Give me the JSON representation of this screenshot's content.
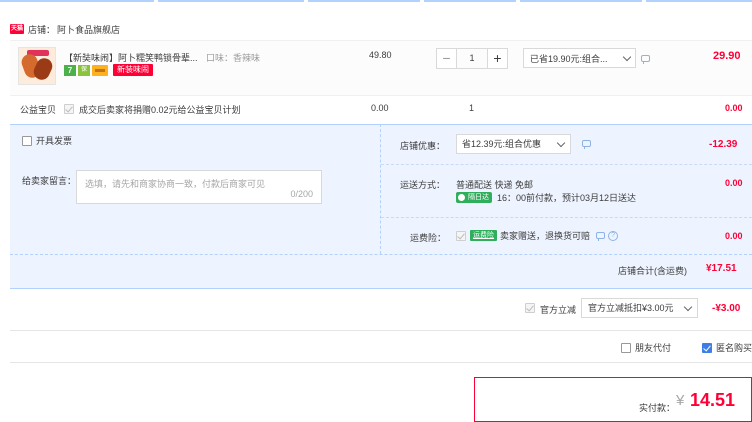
{
  "store": {
    "icon_text": "天猫",
    "label": "店铺：",
    "name": "阿卜食品旗舰店"
  },
  "item": {
    "title": "【新奘味闹】阿卜糯笑鸭锁骨辈...",
    "sku": "口味：香辣味",
    "badge_seven": "7",
    "badge_small": "保",
    "tag": "新装味闹",
    "price": "49.80",
    "quantity": "1",
    "qty_minus": "−",
    "qty_plus": "+",
    "discount_option": "已省19.90元:组合...",
    "total": "29.90"
  },
  "charity": {
    "label": "公益宝贝",
    "text": "成交后卖家将捐赠0.02元给公益宝贝计划",
    "price": "0.00",
    "quantity": "1",
    "total": "0.00"
  },
  "invoice": {
    "label": "开具发票"
  },
  "message": {
    "label": "给卖家留言：",
    "placeholder": "选填，请先和商家协商一致，付款后商家可见",
    "count": "0/200"
  },
  "store_coupon": {
    "label": "店铺优惠：",
    "option": "省12.39元:组合优惠",
    "amount": "-12.39"
  },
  "shipping": {
    "label": "运送方式：",
    "method": "普通配送 快递 免邮",
    "tag": "隔日达",
    "eta": "16：00前付款，预计03月12日送达",
    "amount": "0.00"
  },
  "insurance": {
    "label": "运费险：",
    "tag": "运费险",
    "text": "卖家赠送，退换货可赔",
    "amount": "0.00"
  },
  "store_total": {
    "label": "店铺合计(含运费)",
    "amount": "¥17.51"
  },
  "official": {
    "label": "官方立减",
    "option": "官方立减抵扣¥3.00元",
    "amount": "-¥3.00"
  },
  "options": {
    "friend_pay": "朋友代付",
    "anonymous": "匿名购买"
  },
  "payment": {
    "label": "实付款：",
    "currency": "¥",
    "amount": "14.51"
  },
  "colors": {
    "accent_red": "#ff0036",
    "panel_blue": "#eef4ff",
    "border_blue": "#b2d1ff"
  }
}
